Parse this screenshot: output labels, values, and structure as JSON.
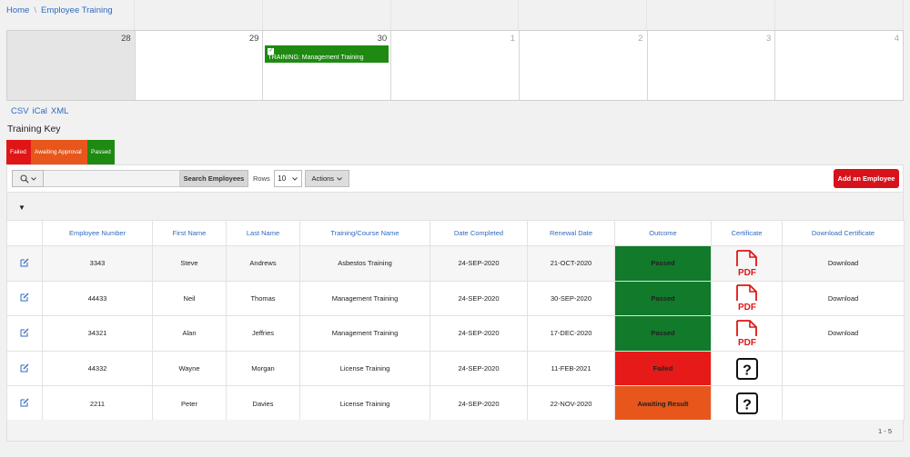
{
  "breadcrumb": {
    "home": "Home",
    "separator": "\\",
    "current": "Employee Training"
  },
  "calendar": {
    "days": [
      {
        "num": "28",
        "past": true,
        "other": false,
        "event": ""
      },
      {
        "num": "29",
        "past": false,
        "other": false,
        "event": ""
      },
      {
        "num": "30",
        "past": false,
        "other": false,
        "event": "TRAINING: Management Training"
      },
      {
        "num": "1",
        "past": false,
        "other": true,
        "event": ""
      },
      {
        "num": "2",
        "past": false,
        "other": true,
        "event": ""
      },
      {
        "num": "3",
        "past": false,
        "other": true,
        "event": ""
      },
      {
        "num": "4",
        "past": false,
        "other": true,
        "event": ""
      }
    ]
  },
  "exports": {
    "csv": "CSV",
    "ical": "iCal",
    "xml": "XML"
  },
  "training_key": {
    "title": "Training Key",
    "failed": "Failed",
    "awaiting": "Awaiting Approval",
    "passed": "Passed"
  },
  "toolbar": {
    "search_button": "Search Employees",
    "rows_label": "Rows",
    "rows_value": "10",
    "actions_label": "Actions",
    "add_button": "Add an Employee"
  },
  "table": {
    "headers": {
      "employee_number": "Employee Number",
      "first_name": "First Name",
      "last_name": "Last Name",
      "course": "Training/Course Name",
      "date_completed": "Date Completed",
      "renewal_date": "Renewal Date",
      "outcome": "Outcome",
      "certificate": "Certificate",
      "download_certificate": "Download Certificate"
    },
    "rows": [
      {
        "emp": "3343",
        "first": "Steve",
        "last": "Andrews",
        "course": "Asbestos Training",
        "completed": "24-SEP-2020",
        "renewal": "21-OCT-2020",
        "outcome": "Passed",
        "cert": "pdf",
        "download": "Download"
      },
      {
        "emp": "44433",
        "first": "Neil",
        "last": "Thomas",
        "course": "Management Training",
        "completed": "24-SEP-2020",
        "renewal": "30-SEP-2020",
        "outcome": "Passed",
        "cert": "pdf",
        "download": "Download"
      },
      {
        "emp": "34321",
        "first": "Alan",
        "last": "Jeffries",
        "course": "Management Training",
        "completed": "24-SEP-2020",
        "renewal": "17-DEC-2020",
        "outcome": "Passed",
        "cert": "pdf",
        "download": "Download"
      },
      {
        "emp": "44332",
        "first": "Wayne",
        "last": "Morgan",
        "course": "License Training",
        "completed": "24-SEP-2020",
        "renewal": "11-FEB-2021",
        "outcome": "Failed",
        "cert": "unknown",
        "download": ""
      },
      {
        "emp": "2211",
        "first": "Peter",
        "last": "Davies",
        "course": "License Training",
        "completed": "24-SEP-2020",
        "renewal": "22-NOV-2020",
        "outcome": "Awaiting Result",
        "cert": "unknown",
        "download": ""
      }
    ]
  },
  "pagination": {
    "label": "1 - 5"
  },
  "colors": {
    "passed": "#117a2b",
    "failed": "#e71a1a",
    "awaiting": "#e8561c",
    "accent": "#2e6bbf",
    "pdf": "#e01616"
  }
}
